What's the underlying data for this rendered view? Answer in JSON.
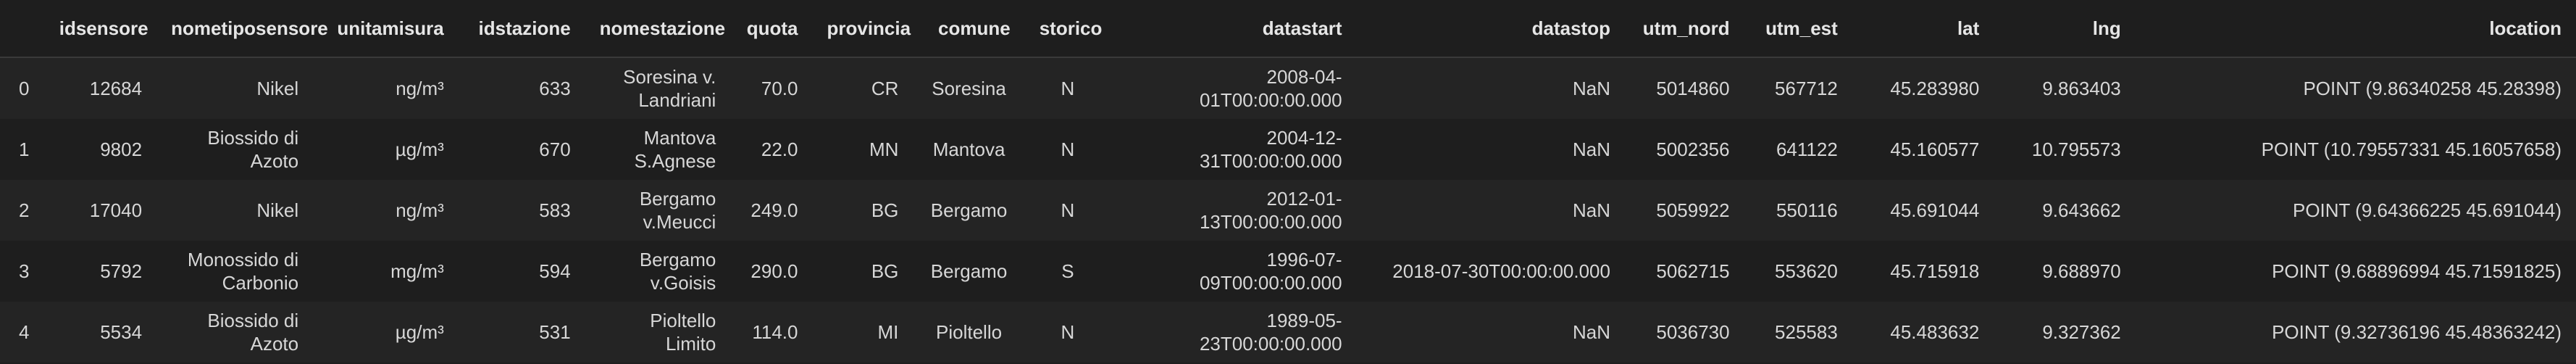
{
  "table": {
    "columns": [
      "",
      "idsensore",
      "nometiposensore",
      "unitamisura",
      "idstazione",
      "nomestazione",
      "quota",
      "provincia",
      "comune",
      "storico",
      "datastart",
      "datastop",
      "utm_nord",
      "utm_est",
      "lat",
      "lng",
      "location"
    ],
    "rows": [
      [
        "0",
        "12684",
        "Nikel",
        "ng/m³",
        "633",
        "Soresina v. Landriani",
        "70.0",
        "CR",
        "Soresina",
        "N",
        "2008-04-01T00:00:00.000",
        "NaN",
        "5014860",
        "567712",
        "45.283980",
        "9.863403",
        "POINT (9.86340258 45.28398)"
      ],
      [
        "1",
        "9802",
        "Biossido di Azoto",
        "µg/m³",
        "670",
        "Mantova S.Agnese",
        "22.0",
        "MN",
        "Mantova",
        "N",
        "2004-12-31T00:00:00.000",
        "NaN",
        "5002356",
        "641122",
        "45.160577",
        "10.795573",
        "POINT (10.79557331 45.16057658)"
      ],
      [
        "2",
        "17040",
        "Nikel",
        "ng/m³",
        "583",
        "Bergamo v.Meucci",
        "249.0",
        "BG",
        "Bergamo",
        "N",
        "2012-01-13T00:00:00.000",
        "NaN",
        "5059922",
        "550116",
        "45.691044",
        "9.643662",
        "POINT (9.64366225 45.691044)"
      ],
      [
        "3",
        "5792",
        "Monossido di Carbonio",
        "mg/m³",
        "594",
        "Bergamo v.Goisis",
        "290.0",
        "BG",
        "Bergamo",
        "S",
        "1996-07-09T00:00:00.000",
        "2018-07-30T00:00:00.000",
        "5062715",
        "553620",
        "45.715918",
        "9.688970",
        "POINT (9.68896994 45.71591825)"
      ],
      [
        "4",
        "5534",
        "Biossido di Azoto",
        "µg/m³",
        "531",
        "Pioltello Limito",
        "114.0",
        "MI",
        "Pioltello",
        "N",
        "1989-05-23T00:00:00.000",
        "NaN",
        "5036730",
        "525583",
        "45.483632",
        "9.327362",
        "POINT (9.32736196 45.48363242)"
      ]
    ]
  }
}
